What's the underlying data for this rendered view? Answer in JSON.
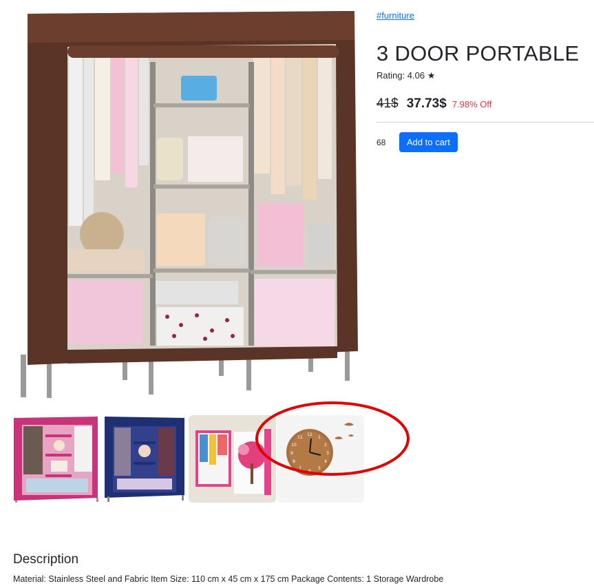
{
  "product": {
    "category_link": "#furniture",
    "title": "3 DOOR PORTABLE",
    "rating_text": "Rating: 4.06 ★",
    "old_price": "41$",
    "new_price": "37.73$",
    "discount": "7.98% Off",
    "quantity": "68",
    "add_to_cart_label": "Add to cart"
  },
  "main_image": {
    "icon": "wardrobe-image",
    "frame_color": "#5a3426"
  },
  "thumbnails": [
    {
      "icon": "pink-wardrobe-image",
      "color": "#c8337a"
    },
    {
      "icon": "navy-wardrobe-image",
      "color": "#1f2f74"
    },
    {
      "icon": "tree-wardrobe-image",
      "color": "#e3438a"
    },
    {
      "icon": "wall-clock-image",
      "color": "#a86f3f"
    }
  ],
  "annotation": {
    "icon": "red-ellipse-highlight",
    "color": "#e00000"
  },
  "description": {
    "heading": "Description",
    "text": "Material: Stainless Steel and Fabric Item Size: 110 cm x 45 cm x 175 cm Package Contents: 1 Storage Wardrobe"
  },
  "colors": {
    "accent": "#0d6efd",
    "discount": "#dc3545"
  }
}
